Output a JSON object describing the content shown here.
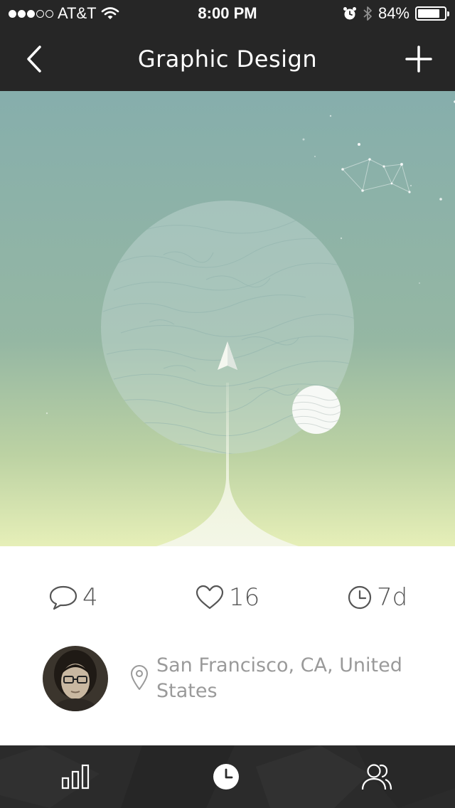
{
  "status_bar": {
    "carrier": "AT&T",
    "time": "8:00 PM",
    "battery_percent_label": "84%",
    "battery_level": 0.84,
    "signal_bars": 3,
    "signal_total": 5
  },
  "nav": {
    "title": "Graphic Design",
    "back_icon": "chevron-left-icon",
    "add_icon": "plus-icon"
  },
  "stats": {
    "comments": "4",
    "likes": "16",
    "age": "7d"
  },
  "post": {
    "location": "San Francisco, CA, United States"
  },
  "tab_bar": {
    "items": [
      {
        "icon": "bar-chart-icon",
        "active": false
      },
      {
        "icon": "clock-icon",
        "active": true
      },
      {
        "icon": "people-icon",
        "active": false
      }
    ]
  },
  "colors": {
    "chrome": "#262626",
    "sky_top": "#86aeac",
    "sky_bottom": "#e6efb8",
    "stat_text": "#555555",
    "location_text": "#9a9a9a"
  }
}
